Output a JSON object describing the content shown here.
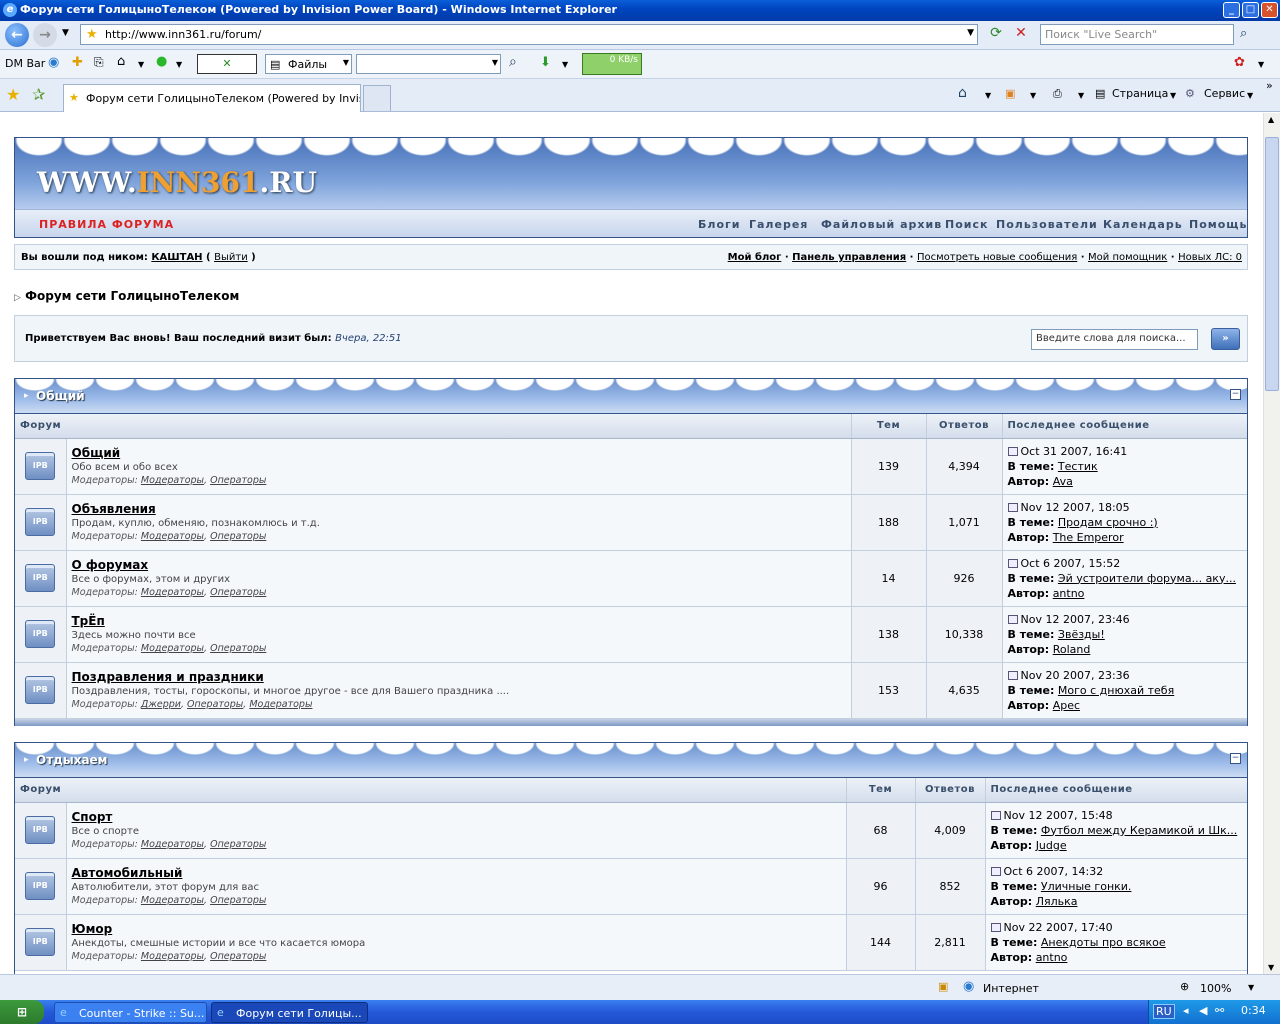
{
  "window": {
    "title": "Форум сети ГолицыноТелеком (Powered by Invision Power Board) - Windows Internet Explorer"
  },
  "address": {
    "url": "http://www.inn361.ru/forum/",
    "search_placeholder": "Поиск \"Live Search\""
  },
  "dmbar": {
    "label": "DM Bar",
    "files_label": "Файлы",
    "speed": "0 KB/s"
  },
  "tab": {
    "label": "Форум сети ГолицыноТелеком (Powered by Invis..."
  },
  "toolbar_right": {
    "page_label": "Страница",
    "service_label": "Сервис"
  },
  "logo": {
    "prefix": "WWW.",
    "accent": "INN361",
    "suffix": ".RU"
  },
  "nav": {
    "rules": "ПРАВИЛА ФОРУМА",
    "items": [
      "Блоги",
      "Галерея",
      "Файловый архив",
      "Поиск",
      "Пользователи",
      "Календарь",
      "Помощь"
    ]
  },
  "userbar": {
    "logged_as": "Вы вошли под ником:",
    "nick": "КАШТАН",
    "logout": "Выйти",
    "my_blog": "Мой блог",
    "panel": "Панель управления",
    "new_posts": "Посмотреть новые сообщения",
    "assistant": "Мой помощник",
    "new_pm": "Новых ЛС: 0"
  },
  "breadcrumb": "Форум сети ГолицыноТелеком",
  "welcome": {
    "text": "Приветствуем Вас вновь! Ваш последний визит был:",
    "when": "Вчера, 22:51",
    "search_placeholder": "Введите слова для поиска..."
  },
  "columns": {
    "forum": "Форум",
    "topics": "Тем",
    "replies": "Ответов",
    "last": "Последнее сообщение",
    "in_topic": "В теме:",
    "author": "Автор:",
    "mods": "Модераторы:"
  },
  "categories": [
    {
      "title": "Общий",
      "forums": [
        {
          "name": "Общий",
          "desc": "Обо всем и обо всех",
          "mods": [
            "Модераторы",
            "Операторы"
          ],
          "topics": "139",
          "replies": "4,394",
          "date": "Oct 31 2007, 16:41",
          "topic": "Тестик",
          "author": "Ava"
        },
        {
          "name": "Объявления",
          "desc": "Продам, куплю, обменяю, познакомлюсь и т.д.",
          "mods": [
            "Модераторы",
            "Операторы"
          ],
          "topics": "188",
          "replies": "1,071",
          "date": "Nov 12 2007, 18:05",
          "topic": "Продам срочно :)",
          "author": "The Emperor"
        },
        {
          "name": "О форумах",
          "desc": "Все о форумах, этом и других",
          "mods": [
            "Модераторы",
            "Операторы"
          ],
          "topics": "14",
          "replies": "926",
          "date": "Oct 6 2007, 15:52",
          "topic": "Эй устроители форума... аку...",
          "author": "antno"
        },
        {
          "name": "ТрЁп",
          "desc": "Здесь можно почти все",
          "mods": [
            "Модераторы",
            "Операторы"
          ],
          "topics": "138",
          "replies": "10,338",
          "date": "Nov 12 2007, 23:46",
          "topic": "Звёзды!",
          "author": "Roland"
        },
        {
          "name": "Поздравления и праздники",
          "desc": "Поздравления, тосты, гороскопы, и многое другое - все для Вашего праздника ....",
          "mods": [
            "Джерри",
            "Операторы",
            "Модераторы"
          ],
          "topics": "153",
          "replies": "4,635",
          "date": "Nov 20 2007, 23:36",
          "topic": "Мого с днюхай тебя",
          "author": "Apec"
        }
      ]
    },
    {
      "title": "Отдыхаем",
      "forums": [
        {
          "name": "Спорт",
          "desc": "Все о спорте",
          "mods": [
            "Модераторы",
            "Операторы"
          ],
          "topics": "68",
          "replies": "4,009",
          "date": "Nov 12 2007, 15:48",
          "topic": "Футбол между Керамикой и Шк...",
          "author": "Judge"
        },
        {
          "name": "Автомобильный",
          "desc": "Автолюбители, этот форум для вас",
          "mods": [
            "Модераторы",
            "Операторы"
          ],
          "topics": "96",
          "replies": "852",
          "date": "Oct 6 2007, 14:32",
          "topic": "Уличные гонки.",
          "author": "Лялька"
        },
        {
          "name": "Юмор",
          "desc": "Анекдоты, смешные истории и все что касается юмора",
          "mods": [
            "Модераторы",
            "Операторы"
          ],
          "topics": "144",
          "replies": "2,811",
          "date": "Nov 22 2007, 17:40",
          "topic": "Анекдоты про всякое",
          "author": "antno"
        }
      ]
    }
  ],
  "statusbar": {
    "zone": "Интернет",
    "zoom": "100%"
  },
  "taskbar": {
    "start": "пуск",
    "tasks": [
      "Counter - Strike :: Su...",
      "Форум сети Голицы..."
    ],
    "lang": "RU",
    "time": "0:34"
  }
}
